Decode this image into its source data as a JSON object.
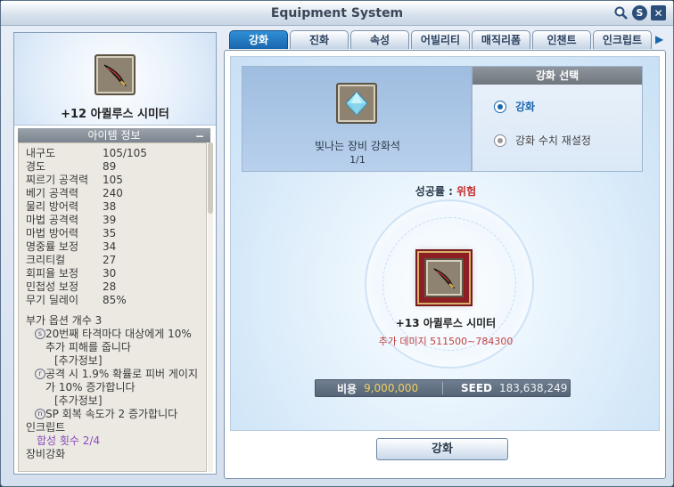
{
  "window": {
    "title": "Equipment System"
  },
  "title_icons": {
    "search": "search-icon",
    "currency": "S",
    "close": "✕"
  },
  "tabs": [
    {
      "label": "강화",
      "active": true
    },
    {
      "label": "진화",
      "active": false
    },
    {
      "label": "속성",
      "active": false
    },
    {
      "label": "어빌리티",
      "active": false
    },
    {
      "label": "매직리폼",
      "active": false
    },
    {
      "label": "인챈트",
      "active": false
    },
    {
      "label": "인크립트",
      "active": false
    }
  ],
  "left": {
    "item_name": "+12 아퀼루스 시미터",
    "info_header": "아이템 정보",
    "minus": "−",
    "stats": [
      {
        "label": "내구도",
        "value": "105/105"
      },
      {
        "label": "경도",
        "value": "89"
      },
      {
        "label": "찌르기 공격력",
        "value": "105"
      },
      {
        "label": "베기 공격력",
        "value": "240"
      },
      {
        "label": "물리 방어력",
        "value": "38"
      },
      {
        "label": "마법 공격력",
        "value": "39"
      },
      {
        "label": "마법 방어력",
        "value": "35"
      },
      {
        "label": "명중률 보정",
        "value": "34"
      },
      {
        "label": "크리티컬",
        "value": "27"
      },
      {
        "label": "회피율 보정",
        "value": "30"
      },
      {
        "label": "민첩성 보정",
        "value": "28"
      },
      {
        "label": "무기 딜레이",
        "value": "85%"
      }
    ],
    "options_title": "부가 옵션 개수 3",
    "options": [
      {
        "badge": "s",
        "text": "20번째 타격마다 대상에게 10% 추가 피해를 줍니다",
        "extra": "[추가정보]"
      },
      {
        "badge": "r",
        "text": "공격 시 1.9% 확률로 피버 게이지가 10% 증가합니다",
        "extra": "[추가정보]"
      },
      {
        "badge": "n",
        "text": "SP 회복 속도가 2 증가합니다",
        "extra": ""
      }
    ],
    "encrypt_title": "인크립트",
    "encrypt_value": "합성 횟수 2/4",
    "enhance_title": "장비강화"
  },
  "stone": {
    "name": "빛나는 장비 강화석",
    "count": "1/1"
  },
  "select": {
    "header": "강화 선택",
    "options": [
      {
        "label": "강화",
        "selected": true
      },
      {
        "label": "강화 수치 재설정",
        "selected": false
      }
    ]
  },
  "success": {
    "label": "성공률 :",
    "value": "위험"
  },
  "target": {
    "name": "+13 아퀼루스 시미터",
    "bonus": "추가 데미지 511500~784300"
  },
  "cost": {
    "cost_label": "비용",
    "cost_value": "9,000,000",
    "seed_label": "SEED",
    "seed_value": "183,638,249"
  },
  "action": {
    "label": "강화"
  },
  "colors": {
    "accent": "#1a66ad",
    "danger": "#c73030",
    "gold": "#f0d060",
    "purple": "#8b4bbd"
  }
}
